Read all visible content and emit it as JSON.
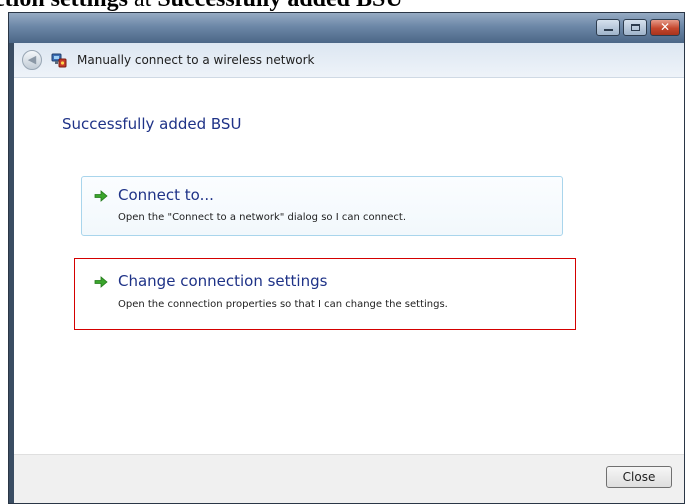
{
  "document": {
    "caption_bold_left": "ction settings",
    "caption_plain": " at ",
    "caption_bold_right": "Successfully added BSU"
  },
  "window": {
    "nav_title": "Manually connect to a wireless network",
    "controls": [
      "minimize-icon",
      "maximize-icon",
      "close-icon"
    ]
  },
  "main": {
    "title": "Successfully added BSU",
    "options": [
      {
        "title": "Connect to...",
        "description": "Open the \"Connect to a network\" dialog so I can connect.",
        "icon": "green-arrow-icon",
        "highlighted": false
      },
      {
        "title": "Change connection settings",
        "description": "Open the connection properties so that I can change the settings.",
        "icon": "green-arrow-icon",
        "highlighted": true
      }
    ]
  },
  "footer": {
    "close_label": "Close"
  },
  "colors": {
    "link_blue": "#1e3287",
    "highlight_red": "#d40000",
    "arrow_green": "#3aa52b",
    "hover_border": "#a9d5ec"
  }
}
